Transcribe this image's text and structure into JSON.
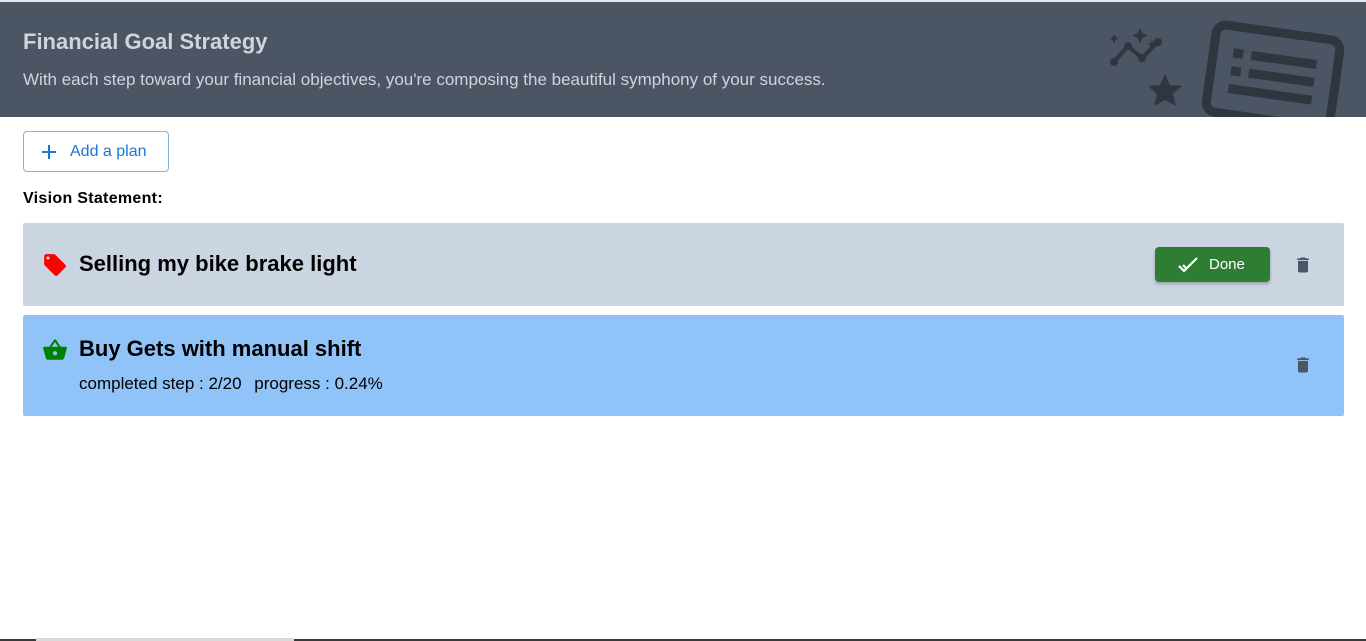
{
  "header": {
    "title": "Financial Goal Strategy",
    "subtitle": "With each step toward your financial objectives, you're composing the beautiful symphony of your success."
  },
  "toolbar": {
    "add_plan_label": "Add a plan"
  },
  "vision_label": "Vision Statement:",
  "plans": [
    {
      "title": "Selling my bike brake light",
      "icon": "tag-icon",
      "done_label": "Done"
    },
    {
      "title": "Buy Gets with manual shift",
      "icon": "basket-icon",
      "completed_step": "completed step : 2/20",
      "progress": "progress : 0.24%"
    }
  ],
  "colors": {
    "header_bg": "#4b5563",
    "accent": "#1976d2",
    "done_green": "#2e7d32",
    "card_gray": "#cbd5e1",
    "card_blue": "#90c4f9",
    "tag_red": "#ff0000",
    "basket_green": "#008000"
  }
}
